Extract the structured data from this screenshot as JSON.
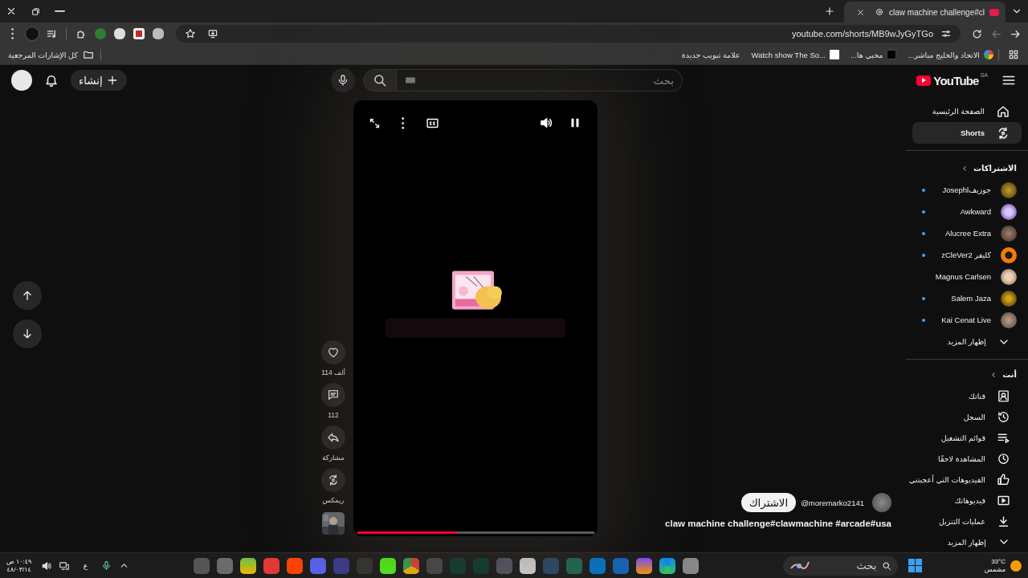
{
  "browser": {
    "tabs": [
      {
        "title": "claw machine challenge#cl",
        "selected": true
      }
    ],
    "url": "youtube.com/shorts/MB9wJyGyTGo",
    "nav_buttons": [
      {
        "kind": "forward",
        "disabled": true
      },
      {
        "kind": "back",
        "disabled": false
      }
    ],
    "all_bookmarks": "كل الإشارات المرجعية",
    "bookmarks": [
      {
        "label": "الاتحاد والخليج مباشر..."
      },
      {
        "label": "محبي ها..."
      },
      {
        "label": "Watch show The So..."
      },
      {
        "label": "علامة تبويب جديدة"
      }
    ]
  },
  "header": {
    "create": "إنشاء",
    "search_placeholder": "بحث",
    "logo": "YouTube",
    "region": "SA"
  },
  "sidebar": {
    "main": [
      {
        "label": "الصفحة الرئيسية",
        "selected": false
      },
      {
        "label": "Shorts",
        "selected": true
      }
    ],
    "subscriptions": {
      "title": "الاشتراكات",
      "channels": [
        {
          "name": "جوزيفJosephl",
          "new": true
        },
        {
          "name": "Awkward",
          "new": true
        },
        {
          "name": "Alucree Extra",
          "new": true
        },
        {
          "name": "كليفر zCleVer2",
          "new": true
        },
        {
          "name": "Magnus Carlsen",
          "new": false
        },
        {
          "name": "Salem Jaza",
          "new": true
        },
        {
          "name": "Kai Cenat Live",
          "new": true
        }
      ],
      "more": "إظهار المزيد"
    },
    "you": {
      "title": "أنت",
      "items": [
        "قناتك",
        "السجل",
        "قوائم التشغيل",
        "المشاهدة لاحقًا",
        "الفيديوهات التي أعجبتني",
        "فيديوهاتك",
        "عمليات التنزيل"
      ],
      "more": "إظهار المزيد"
    }
  },
  "short": {
    "playing": true,
    "muted": false,
    "level": 0.42,
    "liked": false,
    "likes": "114 ألف",
    "comments": "112",
    "share": "مشاركة",
    "remix": "ريمكس",
    "channel": "@moremarko2141",
    "subscribe": "الاشتراك",
    "title": "claw machine challenge#clawmachine #arcade#usa"
  },
  "taskbar": {
    "time": "١٠:٤٩ ص",
    "date": "٤٨/٠٣/١٤",
    "language": "ع",
    "temperature": "33°C",
    "weather": "مشمس",
    "search_placeholder": "بحث"
  }
}
